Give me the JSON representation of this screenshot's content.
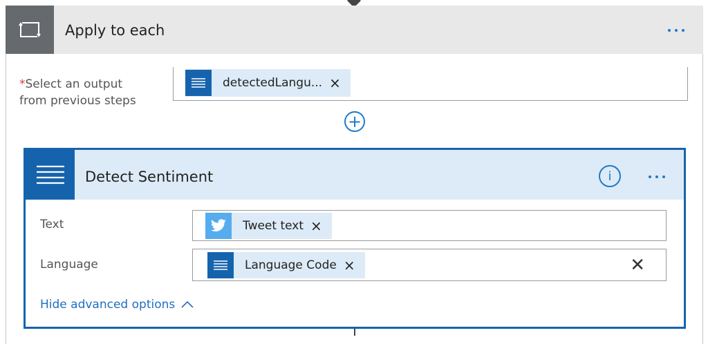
{
  "apply_to_each": {
    "title": "Apply to each",
    "required_marker": "*",
    "select_label_line1": "Select an output",
    "select_label_line2": "from previous steps",
    "selected_token": {
      "label": "detectedLangu...",
      "icon": "text-lines-icon",
      "remove": "×"
    },
    "add_action": "+"
  },
  "detect_sentiment": {
    "title": "Detect Sentiment",
    "info_symbol": "i",
    "fields": {
      "text": {
        "label": "Text",
        "token": {
          "label": "Tweet text",
          "icon": "twitter-bird-icon",
          "remove": "×"
        }
      },
      "language": {
        "label": "Language",
        "token": {
          "label": "Language Code",
          "icon": "text-lines-icon",
          "remove": "×"
        },
        "clear": "✕"
      }
    },
    "advanced_toggle": "Hide advanced options"
  },
  "colors": {
    "accent": "#1663ad",
    "link": "#1f78c8",
    "token_bg": "#dcebf7",
    "loop_header": "#e8e8e8",
    "loop_icon_bg": "#666a6e",
    "twitter": "#55acee",
    "required": "#d83b3b"
  }
}
